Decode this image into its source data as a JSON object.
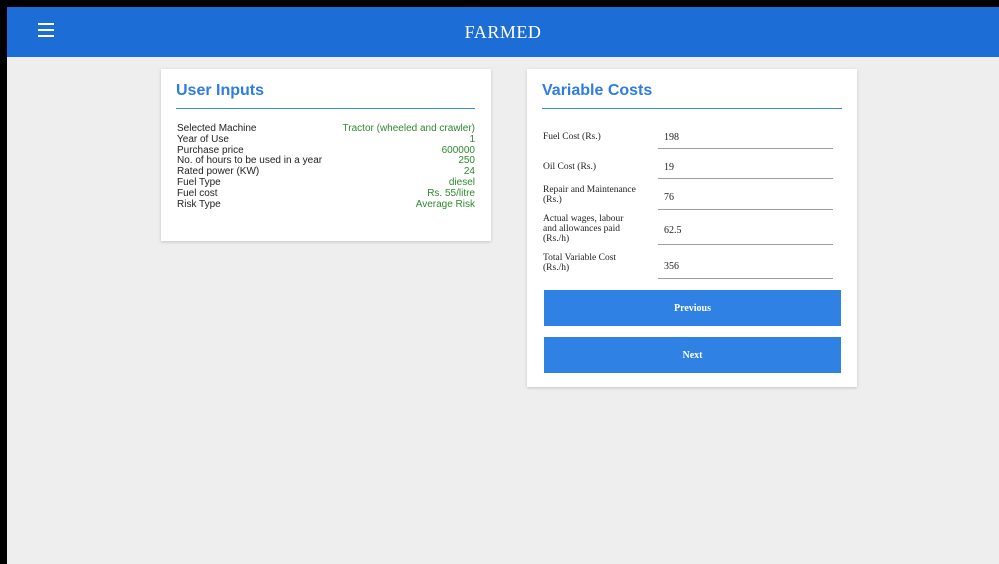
{
  "app": {
    "title": "FARMED",
    "menu_icon": "hamburger-menu-icon"
  },
  "colors": {
    "header": "#1c6ed6",
    "accent": "#2f7de1",
    "button": "#2f81e4",
    "value_green": "#2e8a2e",
    "background": "#eeeeee"
  },
  "user_inputs": {
    "title": "User Inputs",
    "rows": [
      {
        "label": "Selected Machine",
        "value": "Tractor (wheeled and crawler)"
      },
      {
        "label": "Year of Use",
        "value": "1"
      },
      {
        "label": "Purchase price",
        "value": "600000"
      },
      {
        "label": "No. of hours to be used in a year",
        "value": "250"
      },
      {
        "label": "Rated power (KW)",
        "value": "24"
      },
      {
        "label": "Fuel Type",
        "value": "diesel"
      },
      {
        "label": "Fuel cost",
        "value": "Rs. 55/litre"
      },
      {
        "label": "Risk Type",
        "value": "Average Risk"
      }
    ]
  },
  "variable_costs": {
    "title": "Variable Costs",
    "fields": [
      {
        "label": "Fuel Cost (Rs.)",
        "value": "198"
      },
      {
        "label": "Oil Cost (Rs.)",
        "value": "19"
      },
      {
        "label": "Repair and Maintenance (Rs.)",
        "value": "76"
      },
      {
        "label": "Actual wages, labour and allowances paid (Rs./h)",
        "value": "62.5"
      },
      {
        "label": "Total Variable Cost (Rs./h)",
        "value": "356"
      }
    ],
    "previous_label": "Previous",
    "next_label": "Next"
  }
}
